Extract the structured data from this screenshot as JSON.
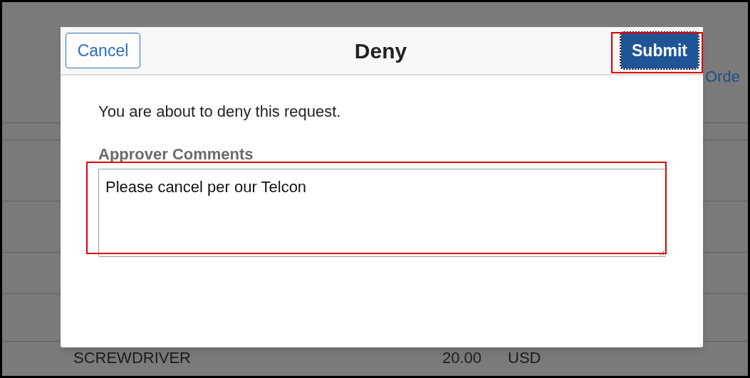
{
  "background": {
    "link": "Orde",
    "row": {
      "item": "SCREWDRIVER",
      "amount": "20.00",
      "currency": "USD"
    }
  },
  "dialog": {
    "title": "Deny",
    "cancel": "Cancel",
    "submit": {
      "label": "Submit",
      "focused": true,
      "highlighted": true
    },
    "message": "You are about to deny this request.",
    "comments": {
      "label": "Approver Comments",
      "value": "Please cancel per our Telcon",
      "highlighted": true
    }
  }
}
